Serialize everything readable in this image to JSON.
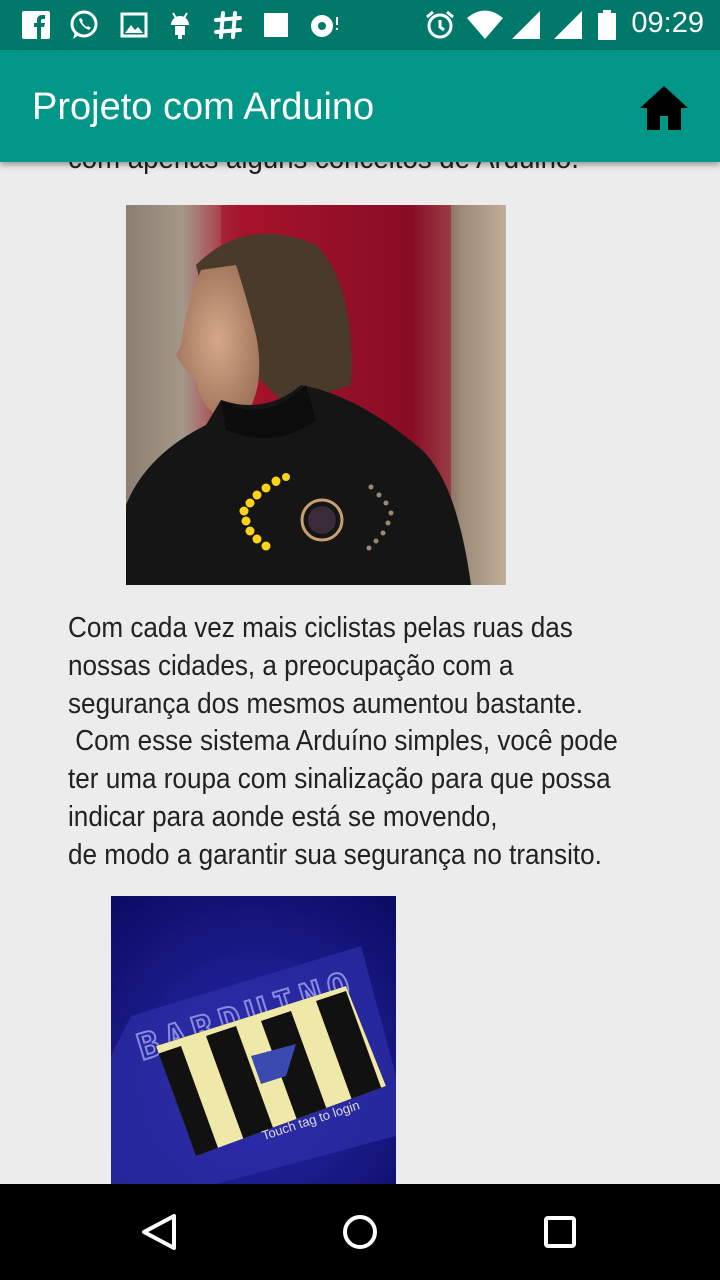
{
  "status_bar": {
    "time": "09:29",
    "left_icons": [
      "facebook-icon",
      "whatsapp-icon",
      "gallery-icon",
      "android-icon",
      "slack-icon",
      "square-icon",
      "music-icon"
    ],
    "right_icons": [
      "alarm-icon",
      "wifi-icon",
      "signal-icon",
      "signal-icon",
      "battery-icon"
    ]
  },
  "app_bar": {
    "title": "Projeto com Arduino",
    "home_icon": "home-icon"
  },
  "content": {
    "partial_line": "com apenas alguns conceitos de Arduino.",
    "paragraph_lines": [
      "Com cada vez mais ciclistas pelas ruas das",
      "nossas cidades, a preocupação com a",
      "segurança dos mesmos aumentou bastante.",
      " Com esse sistema Arduíno simples, você pode",
      "ter uma roupa com sinalização para que possa",
      "indicar para aonde está se movendo,",
      "de modo a garantir sua segurança no transito."
    ],
    "image2_text": {
      "logo": "BARDUINO",
      "caption": "Touch tag to login"
    }
  },
  "nav_bar": {
    "icons": [
      "back-icon",
      "home-circle-icon",
      "recents-icon"
    ]
  },
  "colors": {
    "status_bar": "#00796b",
    "app_bar": "#009688",
    "background": "#ececec",
    "text": "#222222"
  }
}
